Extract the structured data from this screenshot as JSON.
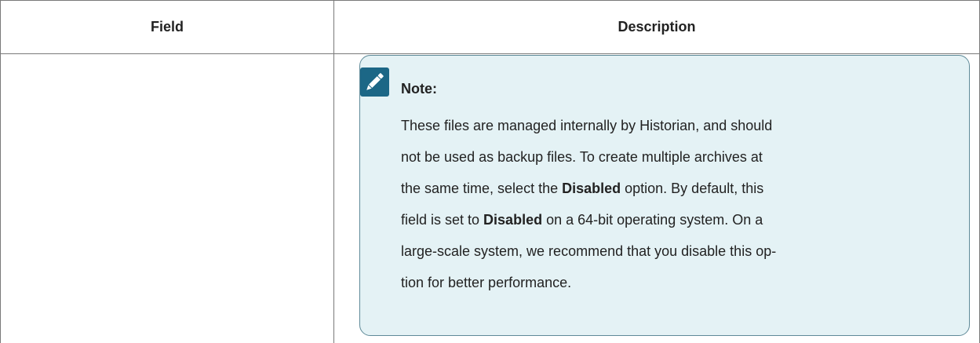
{
  "table": {
    "headers": {
      "field": "Field",
      "description": "Description"
    }
  },
  "note": {
    "icon": "edit-note-icon",
    "title": "Note:",
    "lines": [
      [
        {
          "text": "These files are managed internally by Historian, and should",
          "bold": false
        }
      ],
      [
        {
          "text": "not be used as backup files. To create multiple archives at",
          "bold": false
        }
      ],
      [
        {
          "text": "the same time, select the ",
          "bold": false
        },
        {
          "text": "Disabled",
          "bold": true
        },
        {
          "text": " option. By default, this",
          "bold": false
        }
      ],
      [
        {
          "text": "field is set to ",
          "bold": false
        },
        {
          "text": "Disabled",
          "bold": true
        },
        {
          "text": " on a 64-bit operating system. On a",
          "bold": false
        }
      ],
      [
        {
          "text": "large-scale system, we recommend that you disable this op-",
          "bold": false
        }
      ],
      [
        {
          "text": "tion for better performance.",
          "bold": false
        }
      ]
    ]
  },
  "colors": {
    "note_background": "#e4f2f5",
    "note_border": "#5f8a98",
    "icon_background": "#1c6786",
    "table_border": "#7a7a7a"
  }
}
